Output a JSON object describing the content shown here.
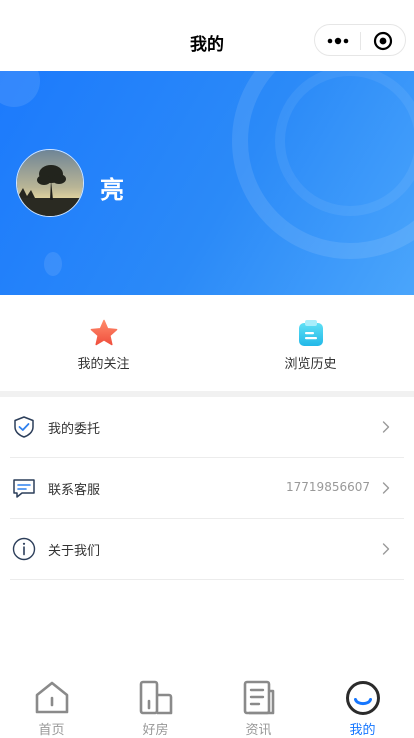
{
  "navbar": {
    "title": "我的"
  },
  "profile": {
    "name": "亮"
  },
  "shortcuts": [
    {
      "label": "我的关注",
      "icon": "star-icon"
    },
    {
      "label": "浏览历史",
      "icon": "history-clipboard-icon"
    }
  ],
  "menu": [
    {
      "label": "我的委托",
      "value": "",
      "icon": "shield-check-icon"
    },
    {
      "label": "联系客服",
      "value": "17719856607",
      "icon": "chat-icon"
    },
    {
      "label": "关于我们",
      "value": "",
      "icon": "info-icon"
    }
  ],
  "tabbar": [
    {
      "label": "首页",
      "icon": "home-icon",
      "active": false
    },
    {
      "label": "好房",
      "icon": "building-icon",
      "active": false
    },
    {
      "label": "资讯",
      "icon": "news-icon",
      "active": false
    },
    {
      "label": "我的",
      "icon": "profile-smile-icon",
      "active": true
    }
  ],
  "colors": {
    "accent": "#1677ff",
    "banner_start": "#1c7afc",
    "banner_end": "#4aa5fb",
    "inactive": "#999999"
  }
}
